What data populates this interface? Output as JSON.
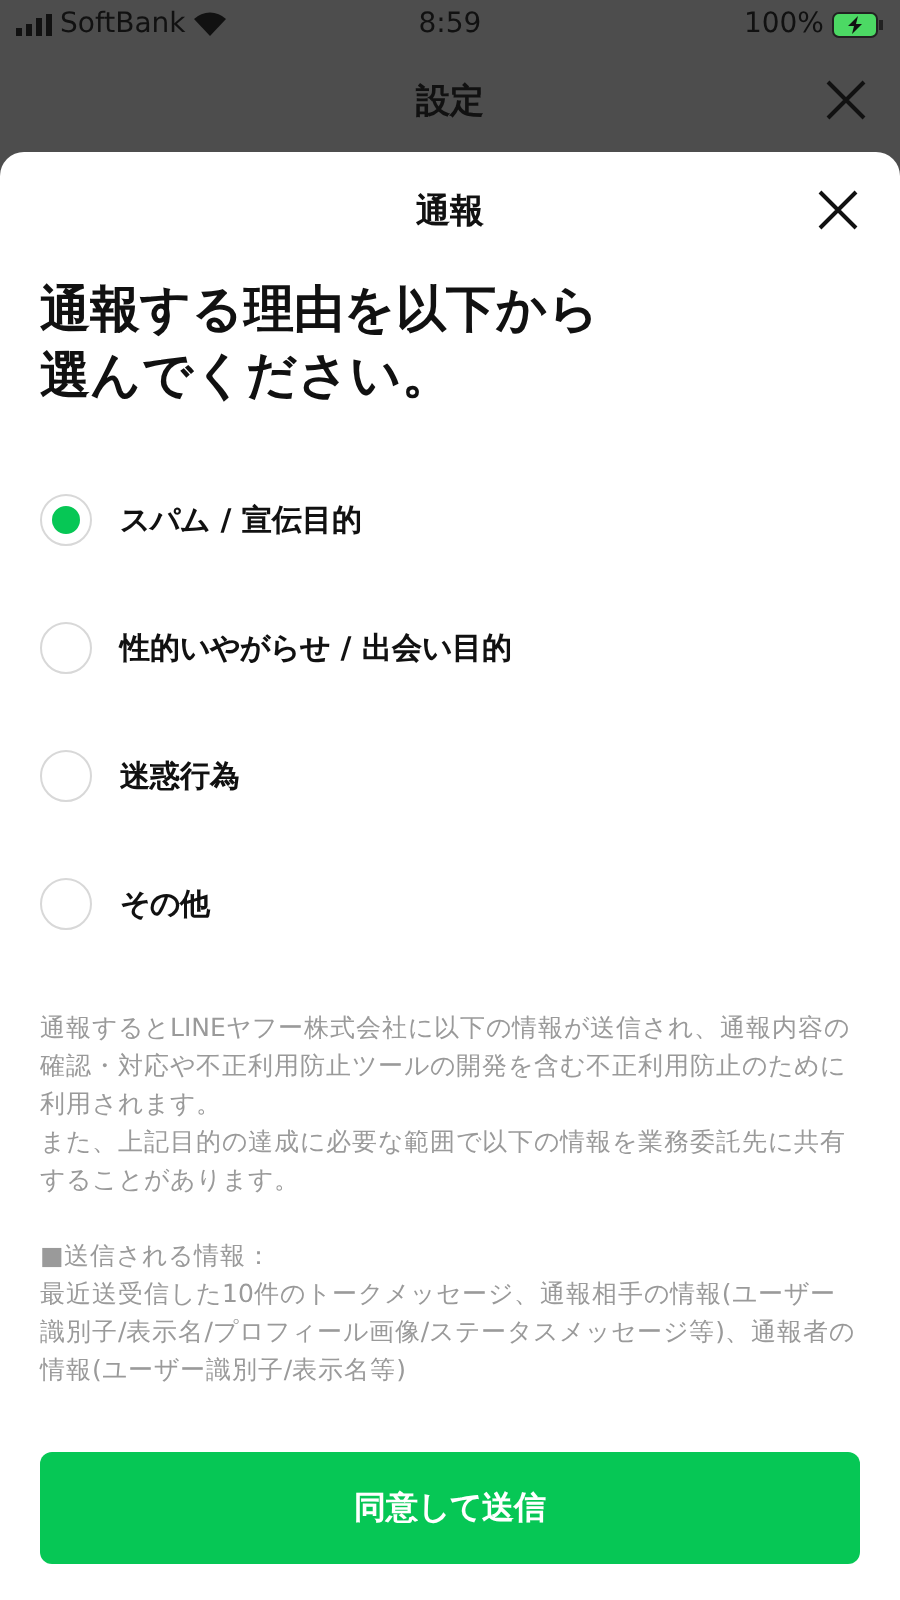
{
  "status_bar": {
    "carrier": "SoftBank",
    "time": "8:59",
    "battery": "100%"
  },
  "background_header": {
    "title": "設定"
  },
  "sheet": {
    "title": "通報",
    "heading": "通報する理由を以下から選んでください。",
    "options": [
      {
        "label": "スパム / 宣伝目的",
        "selected": true
      },
      {
        "label": "性的いやがらせ / 出会い目的",
        "selected": false
      },
      {
        "label": "迷惑行為",
        "selected": false
      },
      {
        "label": "その他",
        "selected": false
      }
    ],
    "notice": [
      "通報するとLINEヤフー株式会社に以下の情報が送信され、通報内容の確認・対応や不正利用防止ツールの開発を含む不正利用防止のために利用されます。",
      "また、上記目的の達成に必要な範囲で以下の情報を業務委託先に共有することがあります。"
    ],
    "info_title": "■送信される情報：",
    "info_body": "最近送受信した10件のトークメッセージ、通報相手の情報(ユーザー識別子/表示名/プロフィール画像/ステータスメッセージ等)、通報者の情報(ユーザー識別子/表示名等)",
    "submit": "同意して送信"
  }
}
